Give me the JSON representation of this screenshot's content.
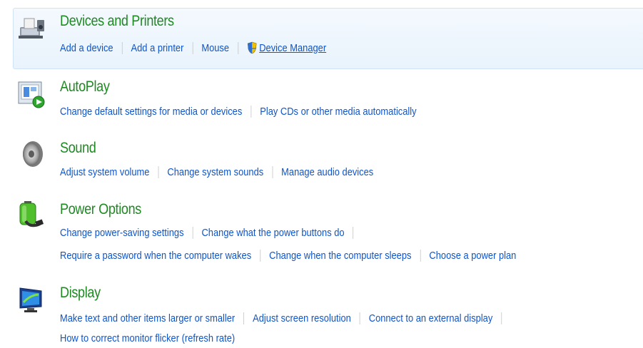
{
  "sections": [
    {
      "title": "Devices and Printers",
      "icon": "devices-printers-icon",
      "rows": [
        [
          "Add a device",
          "Add a printer",
          "Mouse",
          "Device Manager"
        ]
      ]
    },
    {
      "title": "AutoPlay",
      "icon": "autoplay-icon",
      "rows": [
        [
          "Change default settings for media or devices",
          "Play CDs or other media automatically"
        ]
      ]
    },
    {
      "title": "Sound",
      "icon": "speaker-icon",
      "rows": [
        [
          "Adjust system volume",
          "Change system sounds",
          "Manage audio devices"
        ]
      ]
    },
    {
      "title": "Power Options",
      "icon": "battery-plug-icon",
      "rows": [
        [
          "Change power-saving settings",
          "Change what the power buttons do"
        ],
        [
          "Require a password when the computer wakes",
          "Change when the computer sleeps",
          "Choose a power plan"
        ]
      ]
    },
    {
      "title": "Display",
      "icon": "monitor-icon",
      "rows": [
        [
          "Make text and other items larger or smaller",
          "Adjust screen resolution",
          "Connect to an external display"
        ],
        [
          "How to correct monitor flicker (refresh rate)"
        ]
      ]
    }
  ],
  "colors": {
    "title": "#1e8a22",
    "link": "#0f54c8",
    "separator": "#c9c9c9",
    "highlight_bg": "#eaf3fc"
  }
}
